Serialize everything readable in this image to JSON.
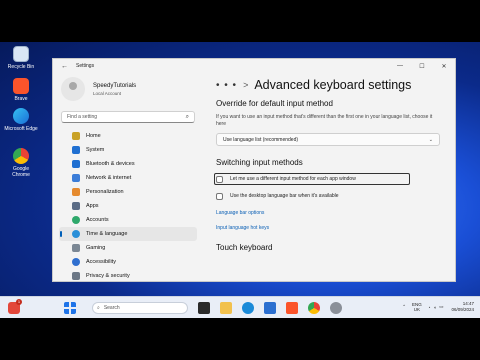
{
  "desktop": {
    "icons": [
      {
        "label": "Recycle Bin",
        "color": "#d9e6f5"
      },
      {
        "label": "Brave",
        "color": "#fb542b"
      },
      {
        "label": "Microsoft Edge",
        "color": "#1aa0d8"
      },
      {
        "label": "Google Chrome",
        "color": "#34a853"
      }
    ]
  },
  "window": {
    "title": "Settings",
    "controls": [
      "—",
      "☐",
      "✕"
    ]
  },
  "profile": {
    "name": "SpeedyTutorials",
    "account": "Local Account"
  },
  "search": {
    "placeholder": "Find a setting"
  },
  "nav": [
    {
      "label": "Home",
      "color": "#c9a227"
    },
    {
      "label": "System",
      "color": "#1f6fd1"
    },
    {
      "label": "Bluetooth & devices",
      "color": "#1f6fd1"
    },
    {
      "label": "Network & internet",
      "color": "#3b7dd8"
    },
    {
      "label": "Personalization",
      "color": "#e58a2e"
    },
    {
      "label": "Apps",
      "color": "#5a6b85"
    },
    {
      "label": "Accounts",
      "color": "#2ea86b"
    },
    {
      "label": "Time & language",
      "color": "#2a8fd8"
    },
    {
      "label": "Gaming",
      "color": "#7b8794"
    },
    {
      "label": "Accessibility",
      "color": "#2f6fcf"
    },
    {
      "label": "Privacy & security",
      "color": "#6b7785"
    }
  ],
  "nav_active_index": 7,
  "content": {
    "breadcrumb_dots": "• • •",
    "breadcrumb_sep": ">",
    "title": "Advanced keyboard settings",
    "override_heading": "Override for default input method",
    "override_desc": "If you want to use an input method that's different than the first one in your language list, choose it here",
    "override_value": "Use language list (recommended)",
    "switching_heading": "Switching input methods",
    "check1": "Let me use a different input method for each app window",
    "check2": "Use the desktop language bar when it's available",
    "link1": "Language bar options",
    "link2": "Input language hot keys",
    "touch_heading": "Touch keyboard"
  },
  "taskbar": {
    "search_placeholder": "Search",
    "badge": "1",
    "lang_top": "ENG",
    "lang_bottom": "UK",
    "time": "14:47",
    "date": "06/09/2024"
  }
}
